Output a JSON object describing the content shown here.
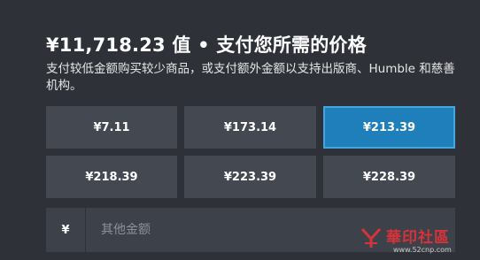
{
  "header": {
    "title": "¥11,718.23 值 • 支付您所需的价格",
    "description": "支付较低金额购买较少商品，或支付额外金额以支持出版商、Humble 和慈善机构。"
  },
  "price_options": [
    {
      "label": "¥7.11",
      "selected": false
    },
    {
      "label": "¥173.14",
      "selected": false
    },
    {
      "label": "¥213.39",
      "selected": true
    },
    {
      "label": "¥218.39",
      "selected": false
    },
    {
      "label": "¥223.39",
      "selected": false
    },
    {
      "label": "¥228.39",
      "selected": false
    }
  ],
  "custom_amount": {
    "currency_symbol": "¥",
    "value": "",
    "placeholder": "其他金额"
  },
  "colors": {
    "background": "#2e3138",
    "button": "#434851",
    "selected": "#1f7fba",
    "selected_border": "#43a6e0",
    "watermark_red": "#d8333a"
  },
  "watermark": {
    "logo_icon": "watermark-logo-icon",
    "main": "華印社區",
    "sub": "www.52cnp.com"
  }
}
